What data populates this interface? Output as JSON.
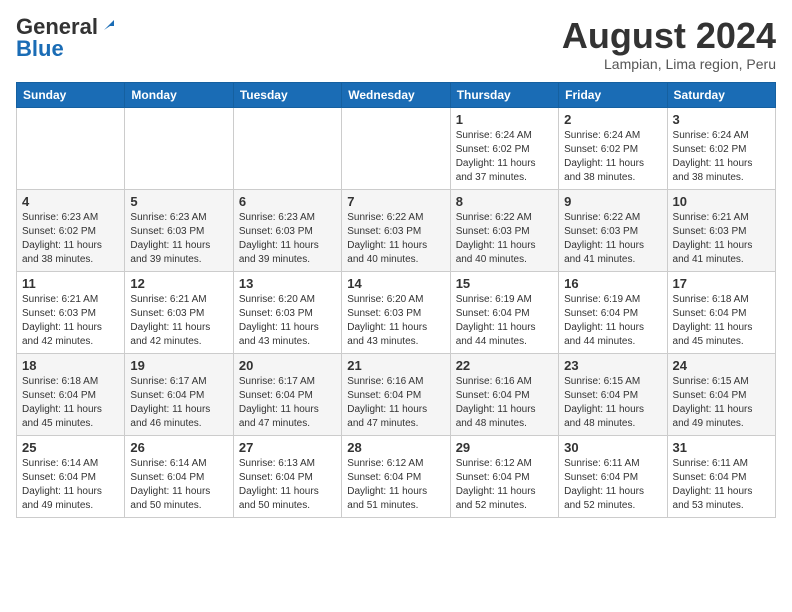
{
  "header": {
    "logo_general": "General",
    "logo_blue": "Blue",
    "month_title": "August 2024",
    "location": "Lampian, Lima region, Peru"
  },
  "days_of_week": [
    "Sunday",
    "Monday",
    "Tuesday",
    "Wednesday",
    "Thursday",
    "Friday",
    "Saturday"
  ],
  "weeks": [
    [
      {
        "day": "",
        "info": ""
      },
      {
        "day": "",
        "info": ""
      },
      {
        "day": "",
        "info": ""
      },
      {
        "day": "",
        "info": ""
      },
      {
        "day": "1",
        "info": "Sunrise: 6:24 AM\nSunset: 6:02 PM\nDaylight: 11 hours and 37 minutes."
      },
      {
        "day": "2",
        "info": "Sunrise: 6:24 AM\nSunset: 6:02 PM\nDaylight: 11 hours and 38 minutes."
      },
      {
        "day": "3",
        "info": "Sunrise: 6:24 AM\nSunset: 6:02 PM\nDaylight: 11 hours and 38 minutes."
      }
    ],
    [
      {
        "day": "4",
        "info": "Sunrise: 6:23 AM\nSunset: 6:02 PM\nDaylight: 11 hours and 38 minutes."
      },
      {
        "day": "5",
        "info": "Sunrise: 6:23 AM\nSunset: 6:03 PM\nDaylight: 11 hours and 39 minutes."
      },
      {
        "day": "6",
        "info": "Sunrise: 6:23 AM\nSunset: 6:03 PM\nDaylight: 11 hours and 39 minutes."
      },
      {
        "day": "7",
        "info": "Sunrise: 6:22 AM\nSunset: 6:03 PM\nDaylight: 11 hours and 40 minutes."
      },
      {
        "day": "8",
        "info": "Sunrise: 6:22 AM\nSunset: 6:03 PM\nDaylight: 11 hours and 40 minutes."
      },
      {
        "day": "9",
        "info": "Sunrise: 6:22 AM\nSunset: 6:03 PM\nDaylight: 11 hours and 41 minutes."
      },
      {
        "day": "10",
        "info": "Sunrise: 6:21 AM\nSunset: 6:03 PM\nDaylight: 11 hours and 41 minutes."
      }
    ],
    [
      {
        "day": "11",
        "info": "Sunrise: 6:21 AM\nSunset: 6:03 PM\nDaylight: 11 hours and 42 minutes."
      },
      {
        "day": "12",
        "info": "Sunrise: 6:21 AM\nSunset: 6:03 PM\nDaylight: 11 hours and 42 minutes."
      },
      {
        "day": "13",
        "info": "Sunrise: 6:20 AM\nSunset: 6:03 PM\nDaylight: 11 hours and 43 minutes."
      },
      {
        "day": "14",
        "info": "Sunrise: 6:20 AM\nSunset: 6:03 PM\nDaylight: 11 hours and 43 minutes."
      },
      {
        "day": "15",
        "info": "Sunrise: 6:19 AM\nSunset: 6:04 PM\nDaylight: 11 hours and 44 minutes."
      },
      {
        "day": "16",
        "info": "Sunrise: 6:19 AM\nSunset: 6:04 PM\nDaylight: 11 hours and 44 minutes."
      },
      {
        "day": "17",
        "info": "Sunrise: 6:18 AM\nSunset: 6:04 PM\nDaylight: 11 hours and 45 minutes."
      }
    ],
    [
      {
        "day": "18",
        "info": "Sunrise: 6:18 AM\nSunset: 6:04 PM\nDaylight: 11 hours and 45 minutes."
      },
      {
        "day": "19",
        "info": "Sunrise: 6:17 AM\nSunset: 6:04 PM\nDaylight: 11 hours and 46 minutes."
      },
      {
        "day": "20",
        "info": "Sunrise: 6:17 AM\nSunset: 6:04 PM\nDaylight: 11 hours and 47 minutes."
      },
      {
        "day": "21",
        "info": "Sunrise: 6:16 AM\nSunset: 6:04 PM\nDaylight: 11 hours and 47 minutes."
      },
      {
        "day": "22",
        "info": "Sunrise: 6:16 AM\nSunset: 6:04 PM\nDaylight: 11 hours and 48 minutes."
      },
      {
        "day": "23",
        "info": "Sunrise: 6:15 AM\nSunset: 6:04 PM\nDaylight: 11 hours and 48 minutes."
      },
      {
        "day": "24",
        "info": "Sunrise: 6:15 AM\nSunset: 6:04 PM\nDaylight: 11 hours and 49 minutes."
      }
    ],
    [
      {
        "day": "25",
        "info": "Sunrise: 6:14 AM\nSunset: 6:04 PM\nDaylight: 11 hours and 49 minutes."
      },
      {
        "day": "26",
        "info": "Sunrise: 6:14 AM\nSunset: 6:04 PM\nDaylight: 11 hours and 50 minutes."
      },
      {
        "day": "27",
        "info": "Sunrise: 6:13 AM\nSunset: 6:04 PM\nDaylight: 11 hours and 50 minutes."
      },
      {
        "day": "28",
        "info": "Sunrise: 6:12 AM\nSunset: 6:04 PM\nDaylight: 11 hours and 51 minutes."
      },
      {
        "day": "29",
        "info": "Sunrise: 6:12 AM\nSunset: 6:04 PM\nDaylight: 11 hours and 52 minutes."
      },
      {
        "day": "30",
        "info": "Sunrise: 6:11 AM\nSunset: 6:04 PM\nDaylight: 11 hours and 52 minutes."
      },
      {
        "day": "31",
        "info": "Sunrise: 6:11 AM\nSunset: 6:04 PM\nDaylight: 11 hours and 53 minutes."
      }
    ]
  ]
}
